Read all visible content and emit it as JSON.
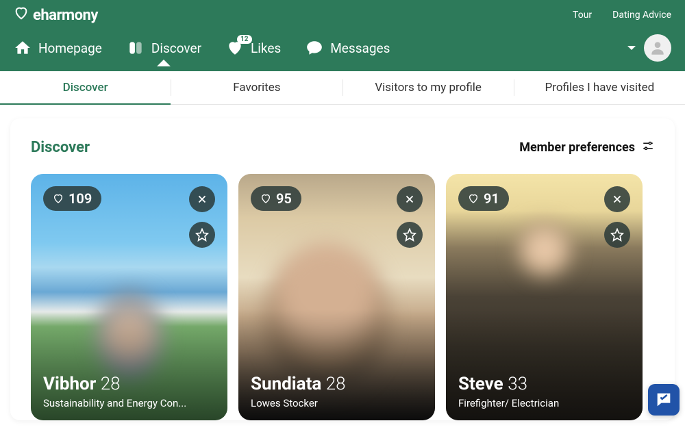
{
  "brand": "eharmony",
  "topLinks": {
    "tour": "Tour",
    "advice": "Dating Advice"
  },
  "nav": {
    "homepage": "Homepage",
    "discover": "Discover",
    "likes": "Likes",
    "likesCount": "12",
    "messages": "Messages"
  },
  "tabs": {
    "discover": "Discover",
    "favorites": "Favorites",
    "visitors": "Visitors to my profile",
    "visited": "Profiles I have visited"
  },
  "section": {
    "title": "Discover",
    "preferences": "Member preferences"
  },
  "cards": [
    {
      "score": "109",
      "name": "Vibhor",
      "age": "28",
      "occupation": "Sustainability and Energy Con..."
    },
    {
      "score": "95",
      "name": "Sundiata",
      "age": "28",
      "occupation": "Lowes Stocker"
    },
    {
      "score": "91",
      "name": "Steve",
      "age": "33",
      "occupation": "Firefighter/ Electrician"
    }
  ]
}
